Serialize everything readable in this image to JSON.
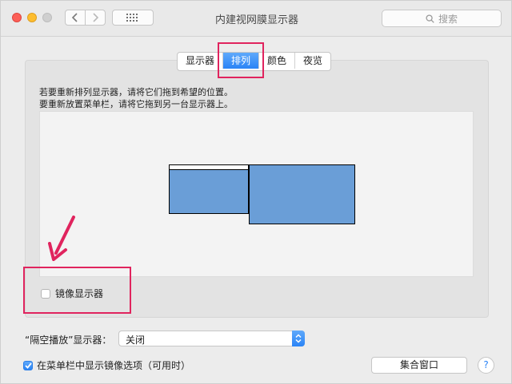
{
  "window": {
    "title": "内建视网膜显示器"
  },
  "search": {
    "placeholder": "搜索"
  },
  "tabs": [
    {
      "label": "显示器",
      "active": false
    },
    {
      "label": "排列",
      "active": true
    },
    {
      "label": "颜色",
      "active": false
    },
    {
      "label": "夜览",
      "active": false
    }
  ],
  "instructions": {
    "line1": "若要重新排列显示器，请将它们拖到希望的位置。",
    "line2": "要重新放置菜单栏，请将它拖到另一台显示器上。"
  },
  "mirror": {
    "label": "镜像显示器",
    "checked": false
  },
  "airplay": {
    "label": "“隔空播放”显示器：",
    "value": "关闭"
  },
  "menubar_option": {
    "label": "在菜单栏中显示镜像选项（可用时）",
    "checked": true
  },
  "buttons": {
    "gather": "集合窗口",
    "help": "?"
  },
  "colors": {
    "accent": "#2a84f6",
    "highlight": "#e0245e",
    "monitor": "#6a9ed7"
  }
}
